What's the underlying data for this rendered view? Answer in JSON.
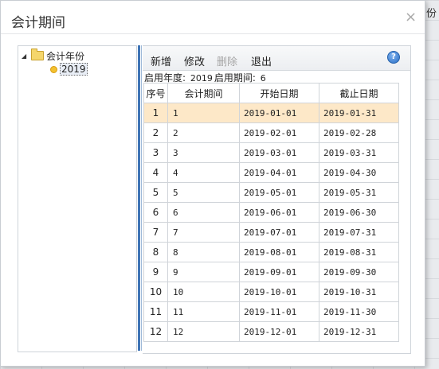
{
  "background": {
    "partial_text": "份"
  },
  "dialog": {
    "title": "会计期间",
    "close_glyph": "×"
  },
  "tree": {
    "root_label": "会计年份",
    "root_icon": "folder-open-icon",
    "child_label": "2019",
    "child_icon": "dot-icon"
  },
  "toolbar": {
    "add_label": "新增",
    "edit_label": "修改",
    "delete_label": "删除",
    "exit_label": "退出",
    "help_glyph": "?"
  },
  "info": {
    "year_label": "启用年度:",
    "year_value": "2019",
    "period_label": "启用期间:",
    "period_value": "6"
  },
  "table": {
    "columns": [
      "序号",
      "会计期间",
      "开始日期",
      "截止日期"
    ],
    "selected_row": 0,
    "rows": [
      {
        "no": "1",
        "period": "1",
        "start": "2019-01-01",
        "end": "2019-01-31"
      },
      {
        "no": "2",
        "period": "2",
        "start": "2019-02-01",
        "end": "2019-02-28"
      },
      {
        "no": "3",
        "period": "3",
        "start": "2019-03-01",
        "end": "2019-03-31"
      },
      {
        "no": "4",
        "period": "4",
        "start": "2019-04-01",
        "end": "2019-04-30"
      },
      {
        "no": "5",
        "period": "5",
        "start": "2019-05-01",
        "end": "2019-05-31"
      },
      {
        "no": "6",
        "period": "6",
        "start": "2019-06-01",
        "end": "2019-06-30"
      },
      {
        "no": "7",
        "period": "7",
        "start": "2019-07-01",
        "end": "2019-07-31"
      },
      {
        "no": "8",
        "period": "8",
        "start": "2019-08-01",
        "end": "2019-08-31"
      },
      {
        "no": "9",
        "period": "9",
        "start": "2019-09-01",
        "end": "2019-09-30"
      },
      {
        "no": "10",
        "period": "10",
        "start": "2019-10-01",
        "end": "2019-10-31"
      },
      {
        "no": "11",
        "period": "11",
        "start": "2019-11-01",
        "end": "2019-11-30"
      },
      {
        "no": "12",
        "period": "12",
        "start": "2019-12-01",
        "end": "2019-12-31"
      }
    ]
  }
}
